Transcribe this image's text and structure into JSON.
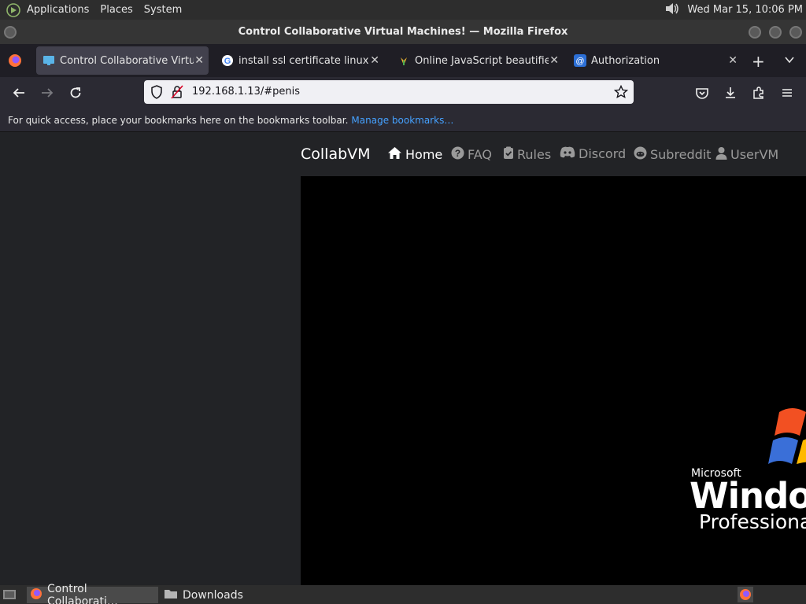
{
  "top_panel": {
    "applications": "Applications",
    "places": "Places",
    "system": "System",
    "clock": "Wed Mar 15, 10:06 PM"
  },
  "window": {
    "title": "Control Collaborative Virtual Machines! — Mozilla Firefox"
  },
  "tabs": [
    {
      "label": "Control Collaborative Virtual Machines!",
      "icon": "monitor-icon"
    },
    {
      "label": "install ssl certificate linux - Google Search",
      "icon": "google-icon"
    },
    {
      "label": "Online JavaScript beautifier",
      "icon": "beautifier-icon"
    },
    {
      "label": "Authorization",
      "icon": "at-sign-icon"
    }
  ],
  "navbar": {
    "url": "192.168.1.13/#penis"
  },
  "bookmarks_bar": {
    "text": "For quick access, place your bookmarks here on the bookmarks toolbar.",
    "manage_link": "Manage bookmarks…"
  },
  "site": {
    "brand": "CollabVM",
    "nav": [
      {
        "label": "Home",
        "icon": "home-icon"
      },
      {
        "label": "FAQ",
        "icon": "question-circle-icon"
      },
      {
        "label": "Rules",
        "icon": "clipboard-check-icon"
      },
      {
        "label": "Discord",
        "icon": "discord-icon"
      },
      {
        "label": "Subreddit",
        "icon": "reddit-icon"
      },
      {
        "label": "UserVM",
        "icon": "user-icon"
      }
    ]
  },
  "vm_screen": {
    "microsoft": "Microsoft",
    "windows": "Windows",
    "edition": "Professional"
  },
  "taskbar": {
    "items": [
      {
        "label": "Control Collaborati…",
        "icon": "firefox-icon"
      },
      {
        "label": "Downloads",
        "icon": "folder-icon"
      }
    ]
  },
  "colors": {
    "accent_link": "#45a1ff",
    "page_bg": "#222326",
    "tabstrip_bg": "#1f1e25"
  }
}
